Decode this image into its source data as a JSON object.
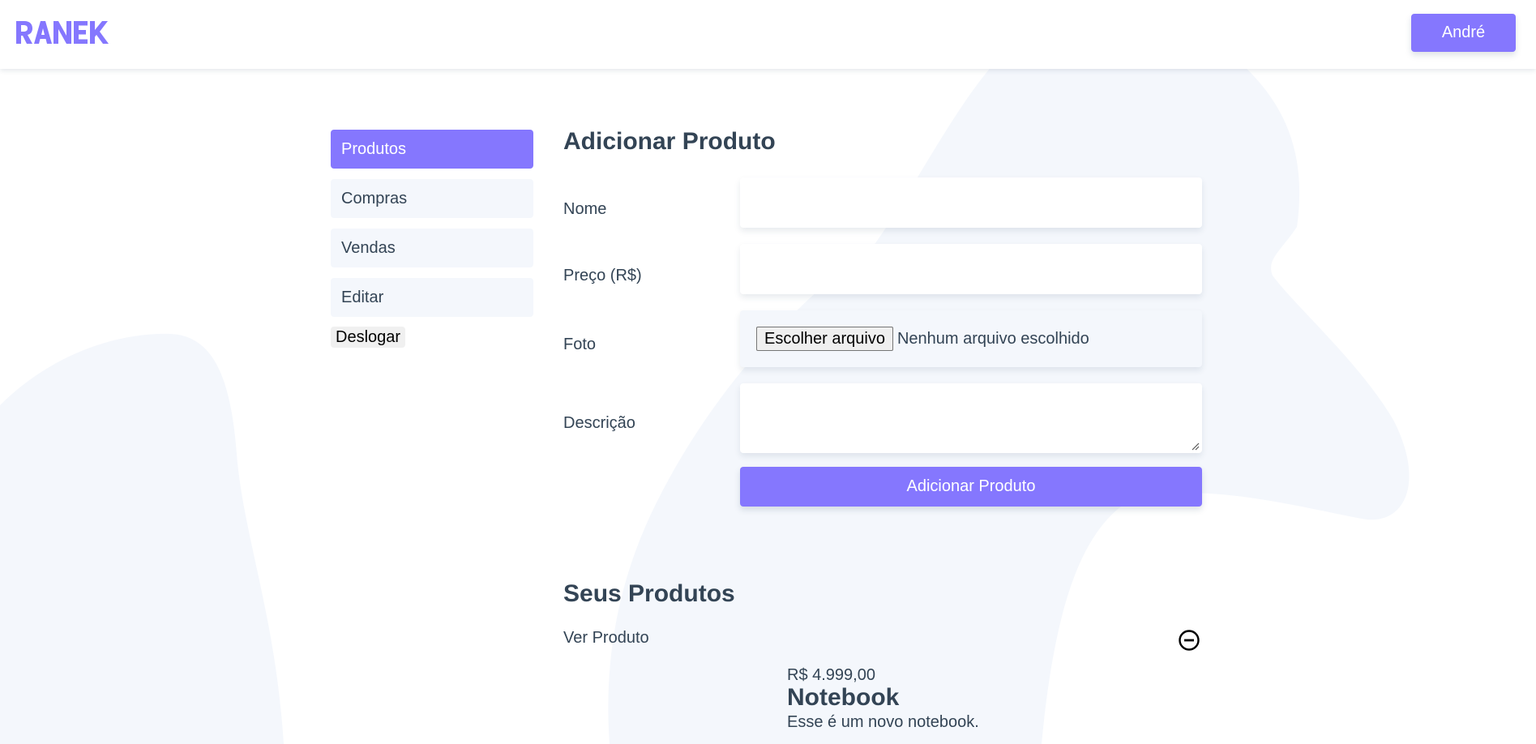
{
  "header": {
    "logo_alt": "RANEK",
    "user_button": "André"
  },
  "colors": {
    "accent": "#8577fe",
    "text": "#345",
    "background_shape": "#f4f7fc"
  },
  "sidebar": {
    "items": [
      {
        "label": "Produtos",
        "active": true
      },
      {
        "label": "Compras",
        "active": false
      },
      {
        "label": "Vendas",
        "active": false
      },
      {
        "label": "Editar",
        "active": false
      }
    ],
    "logout_label": "Deslogar"
  },
  "form": {
    "title": "Adicionar Produto",
    "fields": {
      "name_label": "Nome",
      "name_value": "",
      "price_label": "Preço (R$)",
      "price_value": "",
      "photo_label": "Foto",
      "photo_button": "Escolher arquivo",
      "photo_status": "Nenhum arquivo escolhido",
      "description_label": "Descrição",
      "description_value": ""
    },
    "submit_label": "Adicionar Produto"
  },
  "products": {
    "title": "Seus Produtos",
    "items": [
      {
        "link": "Ver Produto",
        "price": "R$ 4.999,00",
        "name": "Notebook",
        "description": "Esse é um novo notebook.",
        "remove_icon": "minus-circle-icon"
      }
    ]
  }
}
